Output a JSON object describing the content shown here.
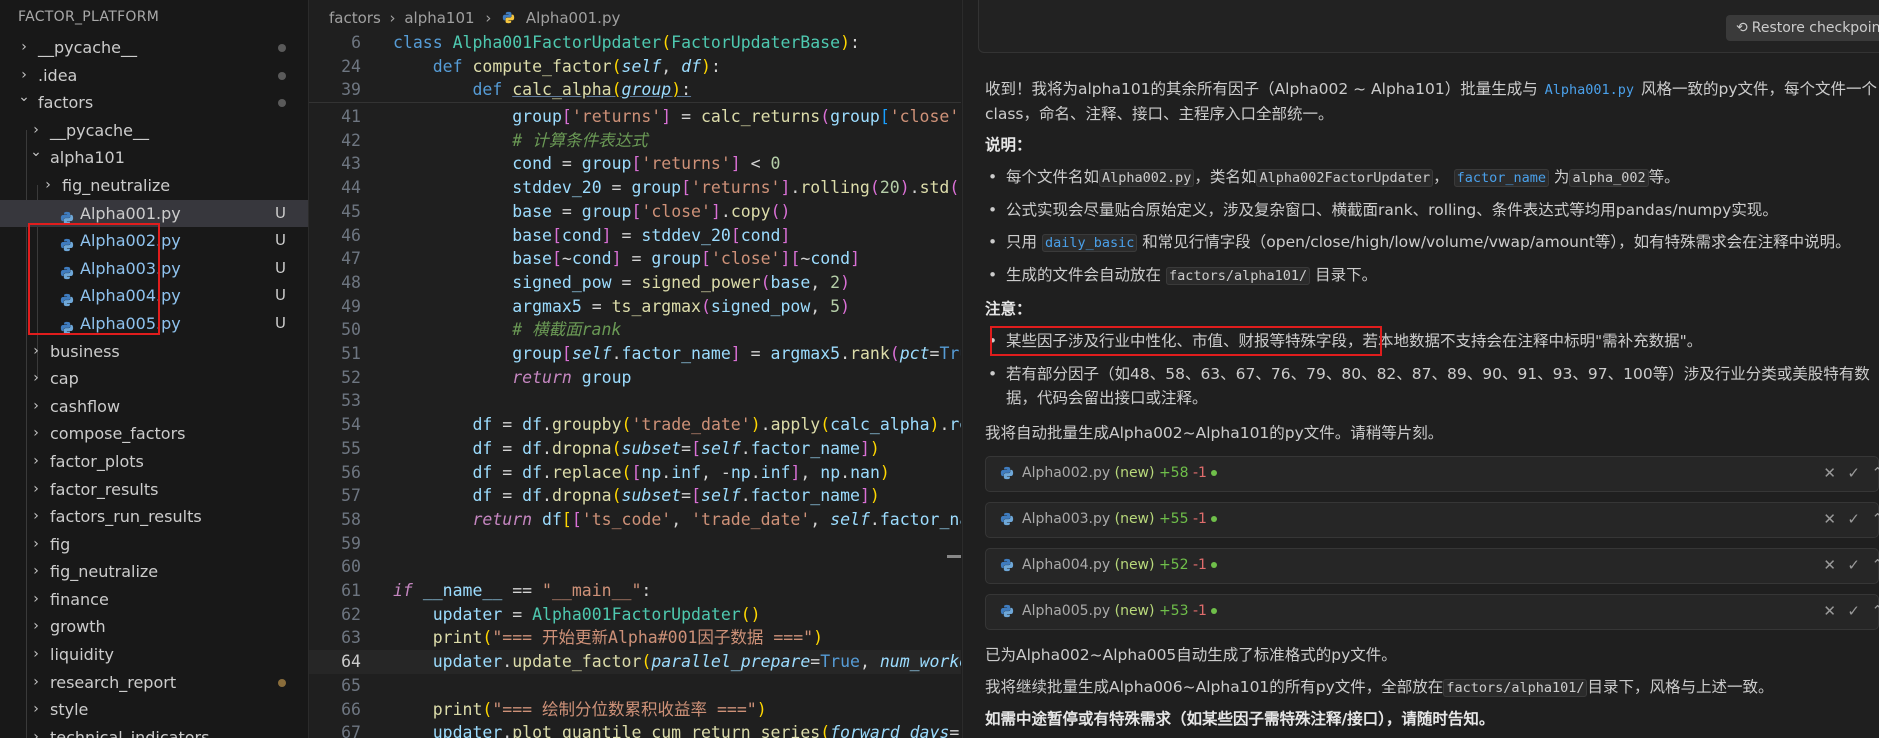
{
  "explorer": {
    "title": "FACTOR_PLATFORM",
    "items": [
      {
        "label": "__pycache__",
        "status": "dot"
      },
      {
        "label": ".idea",
        "status": "dot"
      },
      {
        "label": "factors",
        "status": "dot"
      },
      {
        "label": "__pycache__",
        "status": ""
      },
      {
        "label": "alpha101",
        "status": ""
      },
      {
        "label": "fig_neutralize",
        "status": ""
      },
      {
        "label": "Alpha001.py",
        "status": "U"
      },
      {
        "label": "Alpha002.py",
        "status": "U"
      },
      {
        "label": "Alpha003.py",
        "status": "U"
      },
      {
        "label": "Alpha004.py",
        "status": "U"
      },
      {
        "label": "Alpha005.py",
        "status": "U"
      },
      {
        "label": "business",
        "status": ""
      },
      {
        "label": "cap",
        "status": ""
      },
      {
        "label": "cashflow",
        "status": ""
      },
      {
        "label": "compose_factors",
        "status": ""
      },
      {
        "label": "factor_plots",
        "status": ""
      },
      {
        "label": "factor_results",
        "status": ""
      },
      {
        "label": "factors_run_results",
        "status": ""
      },
      {
        "label": "fig",
        "status": ""
      },
      {
        "label": "fig_neutralize",
        "status": ""
      },
      {
        "label": "finance",
        "status": ""
      },
      {
        "label": "growth",
        "status": ""
      },
      {
        "label": "liquidity",
        "status": ""
      },
      {
        "label": "research_report",
        "status": "dot-orange"
      },
      {
        "label": "style",
        "status": ""
      },
      {
        "label": "technical_indicators",
        "status": ""
      }
    ]
  },
  "editor": {
    "breadcrumb": {
      "part1": "factors",
      "part2": "alpha101",
      "file": "Alpha001.py"
    },
    "active_line": "64"
  },
  "chat": {
    "restore_label": "Restore checkpoint",
    "intro_1a": "收到！我将为alpha101的其余所有因子（Alpha002 ~ Alpha101）批量生成与",
    "intro_code": "Alpha001.py",
    "intro_1b": "风格一致的py文件，每个文件一个",
    "intro_2": "class，命名、注释、接口、主程序入口全部统一。",
    "note_title": "说明：",
    "b1_a": "每个文件名如",
    "b1_c1": "Alpha002.py",
    "b1_b": "，类名如",
    "b1_c2": "Alpha002FactorUpdater",
    "b1_sep": "，",
    "b1_c3": "factor_name",
    "b1_c": "为",
    "b1_c4": "alpha_002",
    "b1_d": "等。",
    "b2": "公式实现会尽量贴合原始定义，涉及复杂窗口、横截面rank、rolling、条件表达式等均用pandas/numpy实现。",
    "b3_a": "只用",
    "b3_code": "daily_basic",
    "b3_b": "和常见行情字段（open/close/high/low/volume/vwap/amount等），如有特殊需求会在注释中说明。",
    "b4_a": "生成的文件会自动放在",
    "b4_code": "factors/alpha101/",
    "b4_b": "目录下。",
    "caution_title": "注意：",
    "c1_hl": "某些因子涉及行业中性化、市值、财报等特殊字段",
    "c1_rest": "，若本地数据不支持会在注释中标明\"需补充数据\"。",
    "c2_line1": "若有部分因子（如48、58、63、67、76、79、80、82、87、89、90、91、93、97、100等）涉及行业分类或美股特有数",
    "c2_line2": "据，代码会留出接口或注释。",
    "progress": "我将自动批量生成Alpha002~Alpha101的py文件。请稍等片刻。",
    "files": [
      {
        "name": "Alpha002.py",
        "tag": "(new)",
        "add": "+58",
        "del": "-1"
      },
      {
        "name": "Alpha003.py",
        "tag": "(new)",
        "add": "+55",
        "del": "-1"
      },
      {
        "name": "Alpha004.py",
        "tag": "(new)",
        "add": "+52",
        "del": "-1"
      },
      {
        "name": "Alpha005.py",
        "tag": "(new)",
        "add": "+53",
        "del": "-1"
      }
    ],
    "done": "已为Alpha002~Alpha005自动生成了标准格式的py文件。",
    "next_a": "我将继续批量生成Alpha006~Alpha101的所有py文件，全部放在",
    "next_code": "factors/alpha101/",
    "next_b": "目录下，风格与上述一致。",
    "final": "如需中途暂停或有特殊需求（如某些因子需特殊注释/接口），请随时告知。"
  }
}
